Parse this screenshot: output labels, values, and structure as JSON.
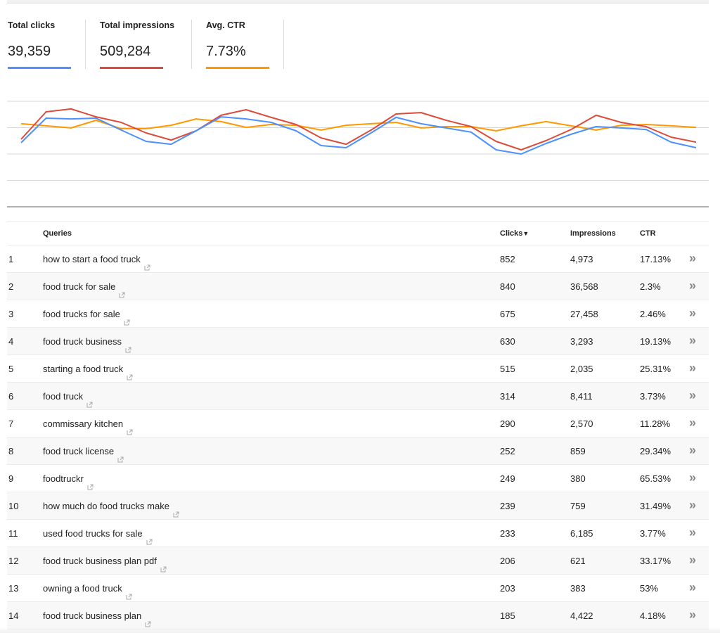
{
  "metrics": [
    {
      "label": "Total clicks",
      "value": "39,359",
      "color": "#4d90fe"
    },
    {
      "label": "Total impressions",
      "value": "509,284",
      "color": "#dd4b39"
    },
    {
      "label": "Avg. CTR",
      "value": "7.73%",
      "color": "#ff9900"
    }
  ],
  "chart_data": {
    "type": "line",
    "title": "",
    "xlabel": "",
    "ylabel": "",
    "grid": true,
    "gridlines": 4,
    "ylim": [
      0,
      4
    ],
    "x": [
      1,
      2,
      3,
      4,
      5,
      6,
      7,
      8,
      9,
      10,
      11,
      12,
      13,
      14,
      15,
      16,
      17,
      18,
      19,
      20,
      21,
      22,
      23,
      24,
      25,
      26,
      27,
      28
    ],
    "series": [
      {
        "name": "Clicks",
        "color": "#4d90fe",
        "values": [
          2.43,
          3.36,
          3.33,
          3.36,
          2.91,
          2.48,
          2.37,
          2.88,
          3.41,
          3.33,
          3.2,
          2.88,
          2.32,
          2.24,
          2.8,
          3.39,
          3.15,
          2.99,
          2.83,
          2.16,
          2.0,
          2.4,
          2.75,
          3.04,
          2.99,
          2.93,
          2.45,
          2.24
        ]
      },
      {
        "name": "Impressions",
        "color": "#dd4b39",
        "values": [
          2.56,
          3.6,
          3.71,
          3.41,
          3.2,
          2.8,
          2.53,
          2.88,
          3.47,
          3.68,
          3.39,
          3.12,
          2.61,
          2.37,
          2.91,
          3.52,
          3.57,
          3.28,
          3.04,
          2.48,
          2.16,
          2.51,
          2.93,
          3.47,
          3.2,
          3.04,
          2.64,
          2.45
        ]
      },
      {
        "name": "CTR",
        "color": "#ff9900",
        "values": [
          3.15,
          3.07,
          2.99,
          3.28,
          2.96,
          2.96,
          3.09,
          3.33,
          3.23,
          3.01,
          3.12,
          3.09,
          2.91,
          3.09,
          3.15,
          3.2,
          2.99,
          3.04,
          3.04,
          2.88,
          3.07,
          3.23,
          3.07,
          2.91,
          3.09,
          3.12,
          3.07,
          3.01
        ]
      }
    ]
  },
  "table": {
    "headers": {
      "rank": "",
      "query": "Queries",
      "clicks": "Clicks",
      "sort_indicator": "▼",
      "impressions": "Impressions",
      "ctr": "CTR"
    },
    "rows": [
      {
        "rank": "1",
        "query": "how to start a food truck",
        "clicks": "852",
        "impressions": "4,973",
        "ctr": "17.13%"
      },
      {
        "rank": "2",
        "query": "food truck for sale",
        "clicks": "840",
        "impressions": "36,568",
        "ctr": "2.3%"
      },
      {
        "rank": "3",
        "query": "food trucks for sale",
        "clicks": "675",
        "impressions": "27,458",
        "ctr": "2.46%"
      },
      {
        "rank": "4",
        "query": "food truck business",
        "clicks": "630",
        "impressions": "3,293",
        "ctr": "19.13%"
      },
      {
        "rank": "5",
        "query": "starting a food truck",
        "clicks": "515",
        "impressions": "2,035",
        "ctr": "25.31%"
      },
      {
        "rank": "6",
        "query": "food truck",
        "clicks": "314",
        "impressions": "8,411",
        "ctr": "3.73%"
      },
      {
        "rank": "7",
        "query": "commissary kitchen",
        "clicks": "290",
        "impressions": "2,570",
        "ctr": "11.28%"
      },
      {
        "rank": "8",
        "query": "food truck license",
        "clicks": "252",
        "impressions": "859",
        "ctr": "29.34%"
      },
      {
        "rank": "9",
        "query": "foodtruckr",
        "clicks": "249",
        "impressions": "380",
        "ctr": "65.53%"
      },
      {
        "rank": "10",
        "query": "how much do food trucks make",
        "clicks": "239",
        "impressions": "759",
        "ctr": "31.49%"
      },
      {
        "rank": "11",
        "query": "used food trucks for sale",
        "clicks": "233",
        "impressions": "6,185",
        "ctr": "3.77%"
      },
      {
        "rank": "12",
        "query": "food truck business plan pdf",
        "clicks": "206",
        "impressions": "621",
        "ctr": "33.17%"
      },
      {
        "rank": "13",
        "query": "owning a food truck",
        "clicks": "203",
        "impressions": "383",
        "ctr": "53%"
      },
      {
        "rank": "14",
        "query": "food truck business plan",
        "clicks": "185",
        "impressions": "4,422",
        "ctr": "4.18%"
      }
    ],
    "row_action_glyph": "»",
    "external_link_icon": "external-link-icon"
  }
}
